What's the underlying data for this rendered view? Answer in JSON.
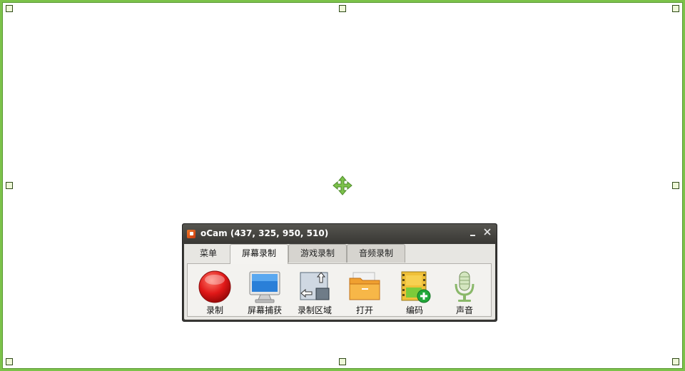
{
  "window": {
    "title": "oCam (437, 325, 950, 510)"
  },
  "tabs": [
    {
      "label": "菜单"
    },
    {
      "label": "屏幕录制"
    },
    {
      "label": "游戏录制"
    },
    {
      "label": "音频录制"
    }
  ],
  "active_tab": "屏幕录制",
  "tools": [
    {
      "label": "录制",
      "icon": "record-icon"
    },
    {
      "label": "屏幕捕获",
      "icon": "monitor-icon"
    },
    {
      "label": "录制区域",
      "icon": "resize-region-icon"
    },
    {
      "label": "打开",
      "icon": "folder-icon"
    },
    {
      "label": "编码",
      "icon": "film-add-icon"
    },
    {
      "label": "声音",
      "icon": "microphone-icon"
    }
  ],
  "colors": {
    "region_border": "#7cc24a",
    "titlebar": "#3b3a37",
    "panel": "#f3f2ef"
  }
}
